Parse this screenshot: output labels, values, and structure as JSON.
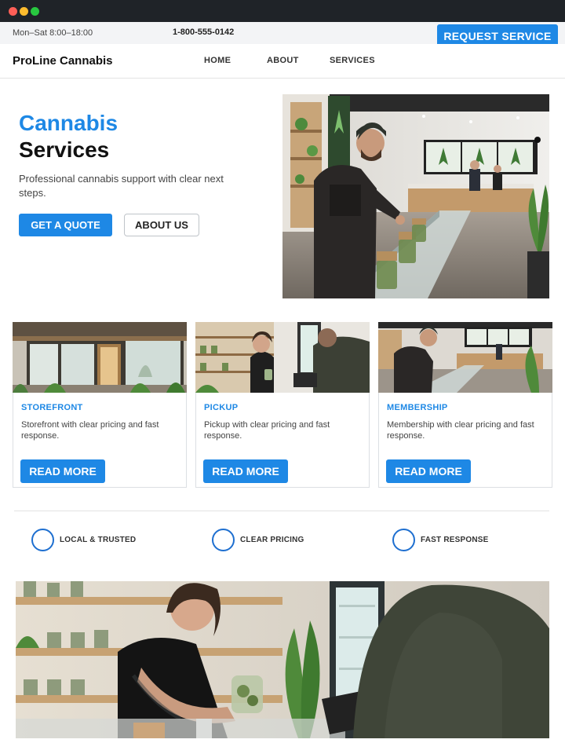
{
  "topbar": {
    "hours": "Mon–Sat 8:00–18:00",
    "phone": "1-800-555-0142",
    "cta": "REQUEST SERVICE"
  },
  "nav": {
    "brand": "ProLine Cannabis",
    "links": [
      "HOME",
      "ABOUT",
      "SERVICES"
    ]
  },
  "hero": {
    "title_accent": "Cannabis",
    "title_main": "Services",
    "subtitle": "Professional cannabis support with clear next steps.",
    "primary_button": "GET A QUOTE",
    "secondary_button": "ABOUT US"
  },
  "cards": [
    {
      "title": "STOREFRONT",
      "text": "Storefront with clear pricing and fast response.",
      "button": "READ MORE"
    },
    {
      "title": "PICKUP",
      "text": "Pickup with clear pricing and fast response.",
      "button": "READ MORE"
    },
    {
      "title": "MEMBERSHIP",
      "text": "Membership with clear pricing and fast response.",
      "button": "READ MORE"
    }
  ],
  "features": [
    "LOCAL & TRUSTED",
    "CLEAR PRICING",
    "FAST RESPONSE"
  ],
  "colors": {
    "accent": "#1e88e5",
    "chrome": "#1f2328",
    "topbar": "#f3f4f6"
  }
}
